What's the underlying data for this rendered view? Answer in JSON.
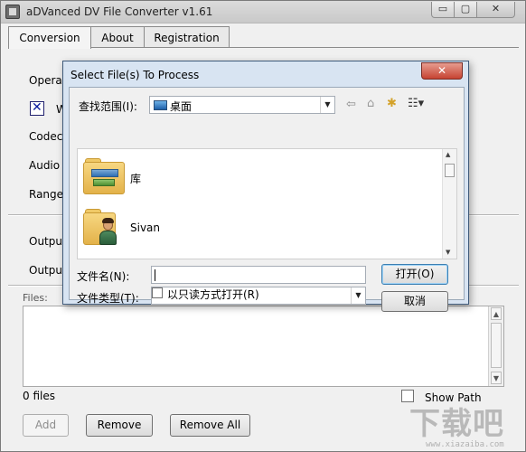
{
  "app": {
    "title": "aDVanced DV File Converter v1.61",
    "tabs": [
      {
        "label": "Conversion",
        "active": true
      },
      {
        "label": "About",
        "active": false
      },
      {
        "label": "Registration",
        "active": false
      }
    ],
    "min_glyph": "▭",
    "max_glyph": "▢",
    "close_glyph": "✕"
  },
  "conversion": {
    "operation_label": "Operat",
    "checkbox_label": "W",
    "checkbox_checked": true,
    "checkbox_mark": "✕",
    "codec_label": "Codec:",
    "audio_label": "Audio I",
    "range_label": "Range:",
    "output_label_1": "Output",
    "output_label_2": "Output",
    "files_label": "Files:",
    "files_count": "0 files",
    "show_path_label": "Show Path",
    "show_path_checked": false,
    "add_button": "Add",
    "remove_button": "Remove",
    "remove_all_button": "Remove All",
    "scroll_up": "▲",
    "scroll_down": "▼"
  },
  "dialog": {
    "title": "Select File(s) To Process",
    "close_glyph": "✕",
    "look_in_label": "查找范围(I):",
    "look_in_value": "桌面",
    "dropdown_glyph": "▼",
    "toolbar": {
      "back_glyph": "⇦",
      "up_folder_glyph": "⌂",
      "new_folder_glyph": "✱",
      "view_menu_glyph": "☷▾"
    },
    "items": [
      {
        "name": "库",
        "icon": "library-folder-icon"
      },
      {
        "name": "Sivan",
        "icon": "user-folder-icon"
      }
    ],
    "file_name_label": "文件名(N):",
    "file_name_value": "",
    "file_type_label": "文件类型(T):",
    "file_type_value": "",
    "open_button": "打开(O)",
    "cancel_button": "取消",
    "readonly_label": "以只读方式打开(R)",
    "readonly_checked": false,
    "scroll_up": "▲",
    "scroll_down": "▼"
  },
  "watermark": {
    "text": "下载吧",
    "url": "www.xiazaiba.com"
  },
  "colors": {
    "dialog_frame": "#d8e4f2",
    "close_button": "#c64332",
    "checkbox_mark": "#0a1b9e"
  }
}
